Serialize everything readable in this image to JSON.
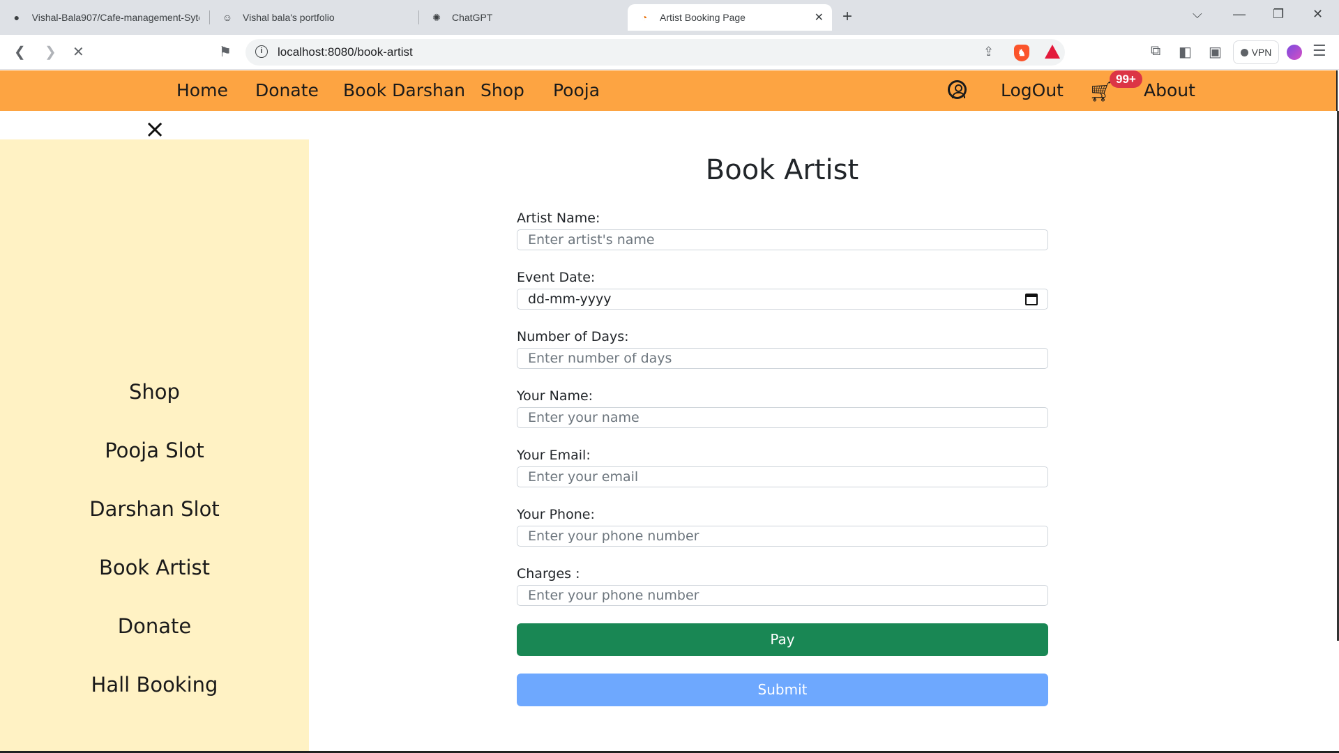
{
  "browser": {
    "tabs": [
      {
        "title": "Vishal-Bala907/Cafe-management-Sytem",
        "icon": "github-icon"
      },
      {
        "title": "Vishal bala's portfolio",
        "icon": "avatar-icon"
      },
      {
        "title": "ChatGPT",
        "icon": "chatgpt-icon"
      },
      {
        "title": "Artist Booking Page",
        "icon": "loading-icon",
        "active": true
      }
    ],
    "url": "localhost:8080/book-artist",
    "vpn_label": "VPN"
  },
  "nav": {
    "links": [
      "Home",
      "Donate",
      "Book Darshan",
      "Shop",
      "Pooja"
    ],
    "logout": "LogOut",
    "cart_badge": "99+",
    "about": "About",
    "background": "#fda442"
  },
  "sidebar": {
    "close_icon": "×",
    "items": [
      "Shop",
      "Pooja Slot",
      "Darshan Slot",
      "Book Artist",
      "Donate",
      "Hall Booking"
    ],
    "background": "#fff2c4"
  },
  "form": {
    "title": "Book Artist",
    "fields": [
      {
        "label": "Artist Name:",
        "placeholder": "Enter artist's name"
      },
      {
        "label": "Event Date:",
        "value": "dd-mm-yyyy"
      },
      {
        "label": "Number of Days:",
        "placeholder": "Enter number of days"
      },
      {
        "label": "Your Name:",
        "placeholder": "Enter your name"
      },
      {
        "label": "Your Email:",
        "placeholder": "Enter your email"
      },
      {
        "label": "Your Phone:",
        "placeholder": "Enter your phone number"
      },
      {
        "label": "Charges :",
        "placeholder": "Enter your phone number"
      }
    ],
    "pay_label": "Pay",
    "submit_label": "Submit",
    "pay_color": "#198754",
    "submit_color": "#6ea8fe"
  }
}
